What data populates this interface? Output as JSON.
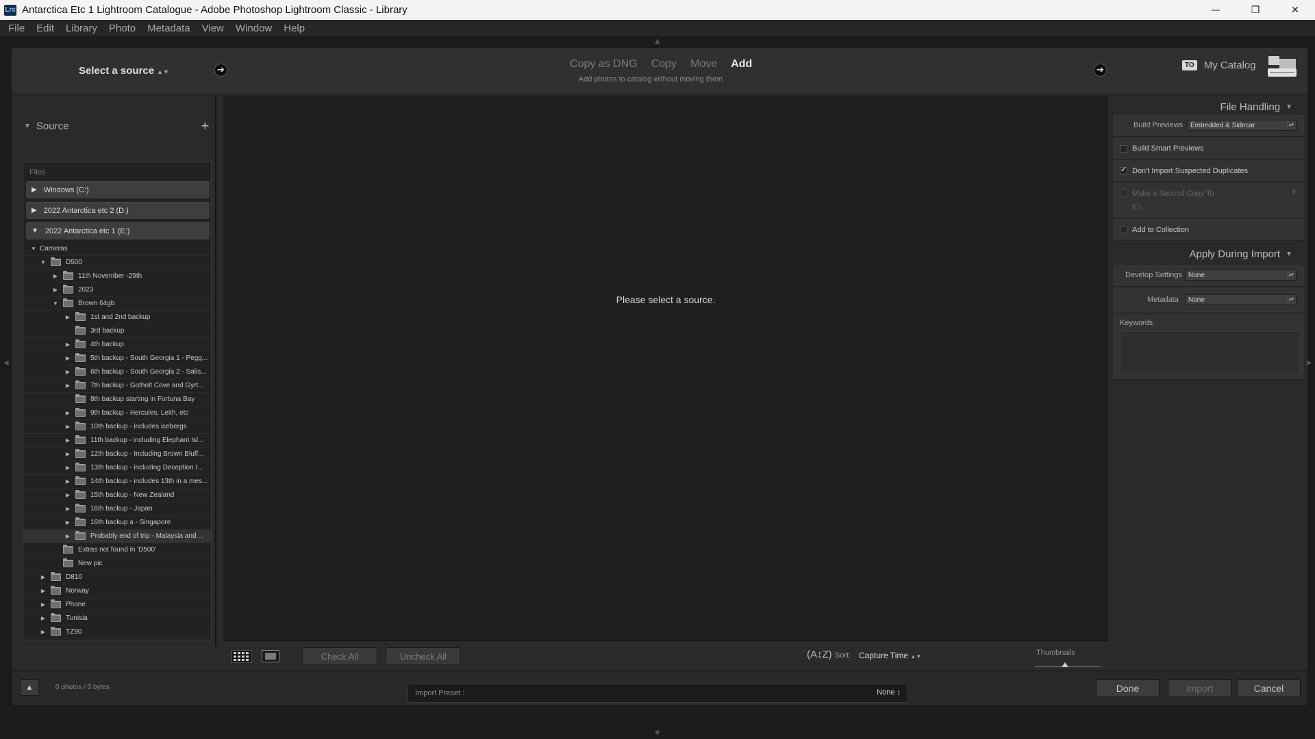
{
  "window": {
    "app_badge": "Lrc",
    "title": "Antarctica Etc 1 Lightroom Catalogue - Adobe Photoshop Lightroom Classic - Library",
    "minimize": "—",
    "maximize": "❐",
    "close": "✕"
  },
  "menu": [
    "File",
    "Edit",
    "Library",
    "Photo",
    "Metadata",
    "View",
    "Window",
    "Help"
  ],
  "import_header": {
    "select_source": "Select a source",
    "modes": [
      "Copy as DNG",
      "Copy",
      "Move",
      "Add"
    ],
    "active_mode": "Add",
    "mode_description": "Add photos to catalog without moving them",
    "to_badge": "TO",
    "destination": "My Catalog"
  },
  "source_panel": {
    "title": "Source",
    "files_label": "Files",
    "volumes": [
      "Windows (C:)",
      "2022 Antarctica etc 2 (D:)",
      "2022 Antarctica etc 1 (E:)"
    ],
    "tree": [
      {
        "label": "Cameras",
        "level": 1,
        "toggle": "open",
        "folder": false
      },
      {
        "label": "D500",
        "level": 2,
        "toggle": "open",
        "folder": true
      },
      {
        "label": "11th November -29th",
        "level": 3,
        "toggle": "closed",
        "folder": true
      },
      {
        "label": "2023",
        "level": 3,
        "toggle": "closed",
        "folder": true
      },
      {
        "label": "Brown 64gb",
        "level": 3,
        "toggle": "open",
        "folder": true
      },
      {
        "label": "1st and 2nd backup",
        "level": 4,
        "toggle": "closed",
        "folder": true
      },
      {
        "label": "3rd backup",
        "level": 4,
        "toggle": "none",
        "folder": true
      },
      {
        "label": "4th backup",
        "level": 4,
        "toggle": "closed",
        "folder": true
      },
      {
        "label": "5th backup - South Georgia 1 - Pegg...",
        "level": 4,
        "toggle": "closed",
        "folder": true
      },
      {
        "label": "6th backup - South Georgia 2 - Salis...",
        "level": 4,
        "toggle": "closed",
        "folder": true
      },
      {
        "label": "7th backup - Gotholt Cove and Gyrt...",
        "level": 4,
        "toggle": "closed",
        "folder": true
      },
      {
        "label": "8th backup starting in Fortuna Bay",
        "level": 4,
        "toggle": "none",
        "folder": true
      },
      {
        "label": "9th backup - Hercules, Leith, etc",
        "level": 4,
        "toggle": "closed",
        "folder": true
      },
      {
        "label": "10th backup - includes icebergs",
        "level": 4,
        "toggle": "closed",
        "folder": true
      },
      {
        "label": "11th backup - including Elephant Isl...",
        "level": 4,
        "toggle": "closed",
        "folder": true
      },
      {
        "label": "12th backup - Including Brown Bluff...",
        "level": 4,
        "toggle": "closed",
        "folder": true
      },
      {
        "label": "13th backup - including  Deception I...",
        "level": 4,
        "toggle": "closed",
        "folder": true
      },
      {
        "label": "14th backup - includes 13th in a mes...",
        "level": 4,
        "toggle": "closed",
        "folder": true
      },
      {
        "label": "15th backup - New Zealand",
        "level": 4,
        "toggle": "closed",
        "folder": true
      },
      {
        "label": "16th backup - Japan",
        "level": 4,
        "toggle": "closed",
        "folder": true
      },
      {
        "label": "16th backup a - Singapore",
        "level": 4,
        "toggle": "closed",
        "folder": true
      },
      {
        "label": "Probably end of trip - Malaysia and ...",
        "level": 4,
        "toggle": "closed",
        "folder": true,
        "selected": true
      },
      {
        "label": "Extras not found in 'D500'",
        "level": 3,
        "toggle": "none",
        "folder": true
      },
      {
        "label": "New pic",
        "level": 3,
        "toggle": "none",
        "folder": true
      },
      {
        "label": "D810",
        "level": 2,
        "toggle": "closed",
        "folder": true
      },
      {
        "label": "Norway",
        "level": 2,
        "toggle": "closed",
        "folder": true
      },
      {
        "label": "Phone",
        "level": 2,
        "toggle": "closed",
        "folder": true
      },
      {
        "label": "Tunisia",
        "level": 2,
        "toggle": "closed",
        "folder": true
      },
      {
        "label": "TZ90",
        "level": 2,
        "toggle": "closed",
        "folder": true
      }
    ]
  },
  "center": {
    "empty_message": "Please select a source.",
    "check_all": "Check All",
    "uncheck_all": "Uncheck All",
    "az_icon_text": "(A↕Z)",
    "sort_label": "Sort:",
    "sort_value": "Capture Time",
    "thumbnails_label": "Thumbnails"
  },
  "file_handling": {
    "title": "File Handling",
    "build_previews_label": "Build Previews",
    "build_previews_value": "Embedded & Sidecar",
    "build_smart_previews": "Build Smart Previews",
    "dont_import_duplicates": "Don't Import Suspected Duplicates",
    "make_second_copy": "Make a Second Copy To",
    "second_copy_path": "E:\\",
    "add_to_collection": "Add to Collection",
    "checkbox_states": {
      "build_smart_previews": false,
      "dont_import_duplicates": true,
      "make_second_copy": false,
      "add_to_collection": false
    }
  },
  "apply_during_import": {
    "title": "Apply During Import",
    "develop_settings_label": "Develop Settings",
    "develop_settings_value": "None",
    "metadata_label": "Metadata",
    "metadata_value": "None",
    "keywords_label": "Keywords"
  },
  "bottom": {
    "photos_count": "0 photos / 0 bytes",
    "preset_label": "Import Preset :",
    "preset_value": "None ↕",
    "done": "Done",
    "import": "Import",
    "cancel": "Cancel"
  }
}
